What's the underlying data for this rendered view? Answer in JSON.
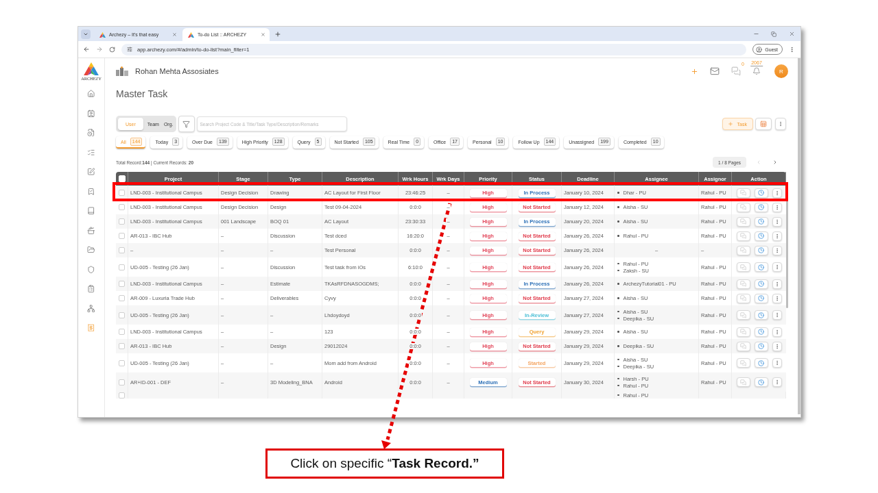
{
  "browser": {
    "tabs": [
      {
        "title": "Archezy – It's that easy",
        "selected": false
      },
      {
        "title": "To-do List :: ARCHEZY",
        "selected": true
      }
    ],
    "url": "app.archezy.com/#/admin/to-do-list?main_filter=1",
    "profile": "Guest"
  },
  "sidebar": {
    "logo_text": "ARCHEZY"
  },
  "header": {
    "company": "Rohan Mehta Assosiates",
    "chat_count": "0",
    "notification_count": "2067",
    "avatar": "R"
  },
  "page_title": "Master Task",
  "toolbar": {
    "scope": [
      {
        "label": "User",
        "selected": true
      },
      {
        "label": "Team",
        "selected": false
      },
      {
        "label": "Org.",
        "selected": false
      }
    ],
    "search": {
      "placeholder": "Search Project Code & Title/Task Type/Description/Remarks"
    },
    "add_button": "Task"
  },
  "filters": [
    {
      "label": "All",
      "count": "144",
      "selected": true
    },
    {
      "label": "Today",
      "count": "3",
      "selected": false
    },
    {
      "label": "Over Due",
      "count": "139",
      "selected": false
    },
    {
      "label": "High Priority",
      "count": "128",
      "selected": false
    },
    {
      "label": "Query",
      "count": "5",
      "selected": false
    },
    {
      "label": "Not Started",
      "count": "105",
      "selected": false
    },
    {
      "label": "Real Time",
      "count": "0",
      "selected": false
    },
    {
      "label": "Office",
      "count": "17",
      "selected": false
    },
    {
      "label": "Personal",
      "count": "10",
      "selected": false
    },
    {
      "label": "Follow Up",
      "count": "144",
      "selected": false
    },
    {
      "label": "Unassigned",
      "count": "199",
      "selected": false
    },
    {
      "label": "Completed",
      "count": "10",
      "selected": false
    }
  ],
  "summary": "Total Record:**144** | Current Records: **20**",
  "pager": {
    "label": "1 / 8 Pages",
    "prev_disabled": true,
    "next_disabled": false
  },
  "table": {
    "select_all_checked": false,
    "columns": [
      "Project",
      "Stage",
      "Type",
      "Description",
      "Wrk Hours",
      "Wrk Days",
      "Priority",
      "Status",
      "Deadline",
      "Assignee",
      "Assignor",
      "Action"
    ],
    "rows": [
      {
        "checked": false,
        "highlighted": true,
        "project": "LND-003 - Institutional Campus",
        "stage": "Design Decision",
        "type": "Drawing",
        "description": "AC Layout for First Floor",
        "wrk_hours": "23:46:25",
        "wrk_days": "–",
        "priority": {
          "label": "High",
          "color": "#e2465a"
        },
        "status": {
          "label": "In Process",
          "color": "#2b6fb6"
        },
        "deadline": "January 10, 2024",
        "assignees": [
          "Dhar - PU"
        ],
        "assignor": "Rahul - PU"
      },
      {
        "checked": false,
        "highlighted": false,
        "project": "LND-003 - Institutional Campus",
        "stage": "Design Decision",
        "type": "Design",
        "description": "Test 09-04-2024",
        "wrk_hours": "0:0:0",
        "wrk_days": "–",
        "priority": {
          "label": "High",
          "color": "#e2465a"
        },
        "status": {
          "label": "Not Started",
          "color": "#e03a4a"
        },
        "deadline": "January 12, 2024",
        "assignees": [
          "Aisha - SU"
        ],
        "assignor": "Rahul - PU"
      },
      {
        "checked": false,
        "highlighted": false,
        "project": "LND-003 - Institutional Campus",
        "stage": "001 Landscape",
        "type": "BOQ 01",
        "description": "AC Layout",
        "wrk_hours": "23:30:33",
        "wrk_days": "–",
        "priority": {
          "label": "High",
          "color": "#e2465a"
        },
        "status": {
          "label": "In Process",
          "color": "#2b6fb6"
        },
        "deadline": "January 20, 2024",
        "assignees": [
          "Aisha - SU"
        ],
        "assignor": "Rahul - PU"
      },
      {
        "checked": false,
        "highlighted": false,
        "project": "AR-013 - IBC Hub",
        "stage": "–",
        "type": "Discussion",
        "description": "Test dced",
        "wrk_hours": "16:20:0",
        "wrk_days": "–",
        "priority": {
          "label": "High",
          "color": "#e2465a"
        },
        "status": {
          "label": "Not Started",
          "color": "#e03a4a"
        },
        "deadline": "January 26, 2024",
        "assignees": [
          "Rahul - PU"
        ],
        "assignor": "Rahul - PU"
      },
      {
        "checked": false,
        "highlighted": false,
        "project": "–",
        "stage": "–",
        "type": "–",
        "description": "Test Personal",
        "wrk_hours": "0:0:0",
        "wrk_days": "–",
        "priority": {
          "label": "High",
          "color": "#e2465a"
        },
        "status": {
          "label": "Not Started",
          "color": "#e03a4a"
        },
        "deadline": "January 26, 2024",
        "assignee_text": "–",
        "assignor": "–"
      },
      {
        "checked": false,
        "highlighted": false,
        "project": "UD-005 - Testing (26 Jan)",
        "stage": "–",
        "type": "Discussion",
        "description": "Test task from iOs",
        "wrk_hours": "6:10:0",
        "wrk_days": "–",
        "priority": {
          "label": "High",
          "color": "#e2465a"
        },
        "status": {
          "label": "Not Started",
          "color": "#e03a4a"
        },
        "deadline": "January 26, 2024",
        "assignees": [
          "Rahul - PU",
          "Zaksh - SU"
        ],
        "assignor": "Rahul - PU"
      },
      {
        "checked": false,
        "highlighted": false,
        "project": "LND-003 - Institutional Campus",
        "stage": "–",
        "type": "Estimate",
        "description": "TKAsRFDNASOGDMS;",
        "wrk_hours": "0:0:0",
        "wrk_days": "–",
        "priority": {
          "label": "High",
          "color": "#e2465a"
        },
        "status": {
          "label": "In Process",
          "color": "#2b6fb6"
        },
        "deadline": "January 26, 2024",
        "assignees": [
          "ArchezyTutorial01 - PU"
        ],
        "assignor": "Rahul - PU"
      },
      {
        "checked": false,
        "highlighted": false,
        "project": "AR-009 - Luxuria Trade Hub",
        "stage": "–",
        "type": "Deliverables",
        "description": "Cyvy",
        "wrk_hours": "0:0:0",
        "wrk_days": "–",
        "priority": {
          "label": "High",
          "color": "#e2465a"
        },
        "status": {
          "label": "Not Started",
          "color": "#e03a4a"
        },
        "deadline": "January 27, 2024",
        "assignees": [
          "Aisha - SU"
        ],
        "assignor": "Rahul - PU"
      },
      {
        "checked": false,
        "highlighted": false,
        "project": "UD-005 - Testing (26 Jan)",
        "stage": "–",
        "type": "–",
        "description": "Lhdoydoyd",
        "wrk_hours": "0:0:0",
        "wrk_days": "–",
        "priority": {
          "label": "High",
          "color": "#e2465a"
        },
        "status": {
          "label": "In-Review",
          "color": "#4bbfd6"
        },
        "deadline": "January 27, 2024",
        "assignees": [
          "Aisha - SU",
          "Deepika - SU"
        ],
        "assignor": "Rahul - PU"
      },
      {
        "checked": false,
        "highlighted": false,
        "project": "LND-003 - Institutional Campus",
        "stage": "–",
        "type": "–",
        "description": "123",
        "wrk_hours": "0:0:0",
        "wrk_days": "–",
        "priority": {
          "label": "High",
          "color": "#e2465a"
        },
        "status": {
          "label": "Query",
          "color": "#f0a12e"
        },
        "deadline": "January 29, 2024",
        "assignees": [
          "Aisha - SU"
        ],
        "assignor": "Rahul - PU"
      },
      {
        "checked": false,
        "highlighted": false,
        "project": "AR-013 - IBC Hub",
        "stage": "–",
        "type": "Design",
        "description": "29012024",
        "wrk_hours": "0:0:0",
        "wrk_days": "–",
        "priority": {
          "label": "High",
          "color": "#e2465a"
        },
        "status": {
          "label": "Not Started",
          "color": "#e03a4a"
        },
        "deadline": "January 29, 2024",
        "assignees": [
          "Deepika - SU"
        ],
        "assignor": "Rahul - PU"
      },
      {
        "checked": false,
        "highlighted": false,
        "project": "UD-005 - Testing (26 Jan)",
        "stage": "–",
        "type": "–",
        "description": "Mom add from Android",
        "wrk_hours": "0:0:0",
        "wrk_days": "–",
        "priority": {
          "label": "High",
          "color": "#e2465a"
        },
        "status": {
          "label": "Started",
          "color": "#f4a460"
        },
        "deadline": "January 29, 2024",
        "assignees": [
          "Aisha - SU",
          "Deepika - SU"
        ],
        "assignor": "Rahul - PU"
      },
      {
        "checked": false,
        "highlighted": false,
        "project": "AR+ID-001 - DEF",
        "stage": "–",
        "type": "3D Modeling_BNA",
        "description": "Android",
        "wrk_hours": "0:0:0",
        "wrk_days": "–",
        "priority": {
          "label": "Medium",
          "color": "#2b6fb6"
        },
        "status": {
          "label": "Not Started",
          "color": "#e03a4a"
        },
        "deadline": "January 30, 2024",
        "assignees": [
          "Harsh - PU",
          "Rahul - PU"
        ],
        "assignor": "Rahul - PU"
      }
    ],
    "partial_row": {
      "checked": false,
      "assignees": [
        "Rahul - PU"
      ]
    }
  },
  "callout": "Click on specific “**Task Record.”**"
}
